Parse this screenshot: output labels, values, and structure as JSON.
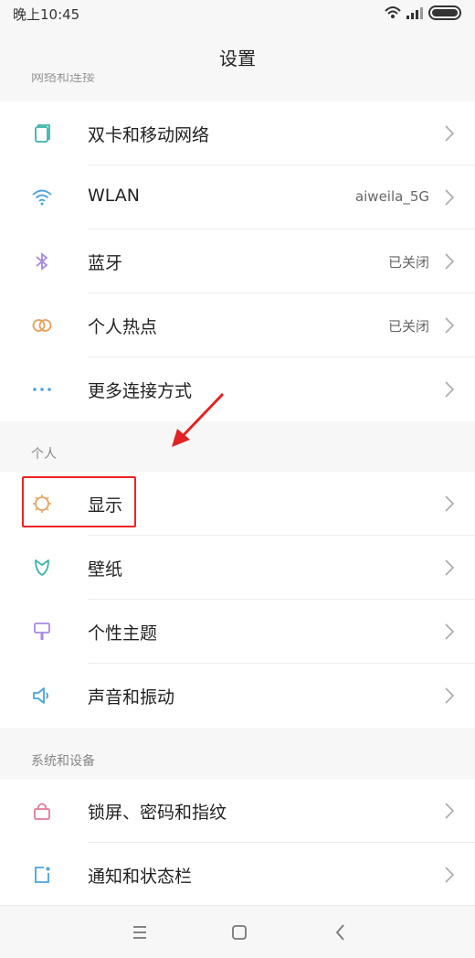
{
  "status_bar": {
    "time": "晚上10:45"
  },
  "title": "设置",
  "cut_off_header": "网络和连接",
  "sections": {
    "personal_header": "个人",
    "system_header": "系统和设备"
  },
  "rows": {
    "dual_sim": {
      "label": "双卡和移动网络",
      "icon": "sim-card-icon"
    },
    "wlan": {
      "label": "WLAN",
      "value": "aiweila_5G",
      "icon": "wifi-icon"
    },
    "bluetooth": {
      "label": "蓝牙",
      "value": "已关闭",
      "icon": "bluetooth-icon"
    },
    "hotspot": {
      "label": "个人热点",
      "value": "已关闭",
      "icon": "hotspot-icon"
    },
    "more_connections": {
      "label": "更多连接方式",
      "icon": "more-dots-icon"
    },
    "display": {
      "label": "显示",
      "icon": "display-sun-icon"
    },
    "wallpaper": {
      "label": "壁纸",
      "icon": "wallpaper-icon"
    },
    "theme": {
      "label": "个性主题",
      "icon": "theme-brush-icon"
    },
    "sound": {
      "label": "声音和振动",
      "icon": "speaker-icon"
    },
    "lock": {
      "label": "锁屏、密码和指纹",
      "icon": "lock-icon"
    },
    "notifications": {
      "label": "通知和状态栏",
      "icon": "notification-icon"
    }
  },
  "colors": {
    "highlight": "#e22222",
    "arrow": "#e22222",
    "icon_teal": "#3bb3a8",
    "icon_blue": "#4aa3df",
    "icon_purple": "#a68be0",
    "icon_orange": "#e6a05a",
    "icon_pink": "#e07a95"
  }
}
